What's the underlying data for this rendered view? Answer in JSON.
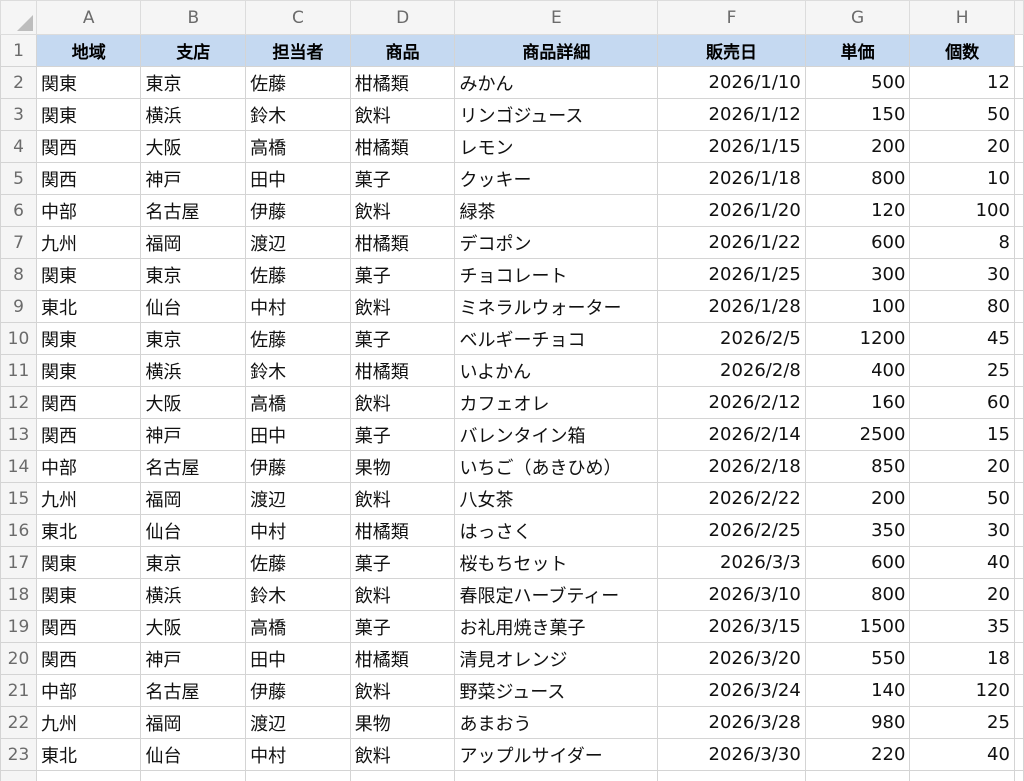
{
  "columns": [
    "A",
    "B",
    "C",
    "D",
    "E",
    "F",
    "G",
    "H"
  ],
  "header": [
    "地域",
    "支店",
    "担当者",
    "商品",
    "商品詳細",
    "販売日",
    "単価",
    "個数"
  ],
  "rows": [
    [
      "関東",
      "東京",
      "佐藤",
      "柑橘類",
      "みかん",
      "2026/1/10",
      "500",
      "12"
    ],
    [
      "関東",
      "横浜",
      "鈴木",
      "飲料",
      "リンゴジュース",
      "2026/1/12",
      "150",
      "50"
    ],
    [
      "関西",
      "大阪",
      "高橋",
      "柑橘類",
      "レモン",
      "2026/1/15",
      "200",
      "20"
    ],
    [
      "関西",
      "神戸",
      "田中",
      "菓子",
      "クッキー",
      "2026/1/18",
      "800",
      "10"
    ],
    [
      "中部",
      "名古屋",
      "伊藤",
      "飲料",
      "緑茶",
      "2026/1/20",
      "120",
      "100"
    ],
    [
      "九州",
      "福岡",
      "渡辺",
      "柑橘類",
      "デコポン",
      "2026/1/22",
      "600",
      "8"
    ],
    [
      "関東",
      "東京",
      "佐藤",
      "菓子",
      "チョコレート",
      "2026/1/25",
      "300",
      "30"
    ],
    [
      "東北",
      "仙台",
      "中村",
      "飲料",
      "ミネラルウォーター",
      "2026/1/28",
      "100",
      "80"
    ],
    [
      "関東",
      "東京",
      "佐藤",
      "菓子",
      "ベルギーチョコ",
      "2026/2/5",
      "1200",
      "45"
    ],
    [
      "関東",
      "横浜",
      "鈴木",
      "柑橘類",
      "いよかん",
      "2026/2/8",
      "400",
      "25"
    ],
    [
      "関西",
      "大阪",
      "高橋",
      "飲料",
      "カフェオレ",
      "2026/2/12",
      "160",
      "60"
    ],
    [
      "関西",
      "神戸",
      "田中",
      "菓子",
      "バレンタイン箱",
      "2026/2/14",
      "2500",
      "15"
    ],
    [
      "中部",
      "名古屋",
      "伊藤",
      "果物",
      "いちご（あきひめ）",
      "2026/2/18",
      "850",
      "20"
    ],
    [
      "九州",
      "福岡",
      "渡辺",
      "飲料",
      "八女茶",
      "2026/2/22",
      "200",
      "50"
    ],
    [
      "東北",
      "仙台",
      "中村",
      "柑橘類",
      "はっさく",
      "2026/2/25",
      "350",
      "30"
    ],
    [
      "関東",
      "東京",
      "佐藤",
      "菓子",
      "桜もちセット",
      "2026/3/3",
      "600",
      "40"
    ],
    [
      "関東",
      "横浜",
      "鈴木",
      "飲料",
      "春限定ハーブティー",
      "2026/3/10",
      "800",
      "20"
    ],
    [
      "関西",
      "大阪",
      "高橋",
      "菓子",
      "お礼用焼き菓子",
      "2026/3/15",
      "1500",
      "35"
    ],
    [
      "関西",
      "神戸",
      "田中",
      "柑橘類",
      "清見オレンジ",
      "2026/3/20",
      "550",
      "18"
    ],
    [
      "中部",
      "名古屋",
      "伊藤",
      "飲料",
      "野菜ジュース",
      "2026/3/24",
      "140",
      "120"
    ],
    [
      "九州",
      "福岡",
      "渡辺",
      "果物",
      "あまおう",
      "2026/3/28",
      "980",
      "25"
    ],
    [
      "東北",
      "仙台",
      "中村",
      "飲料",
      "アップルサイダー",
      "2026/3/30",
      "220",
      "40"
    ]
  ],
  "numeric_columns": [
    5,
    6,
    7
  ],
  "header_fill": "#c5d9f1"
}
